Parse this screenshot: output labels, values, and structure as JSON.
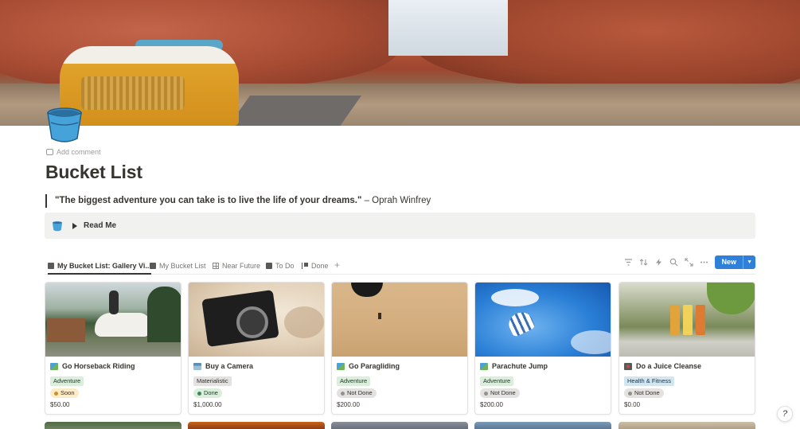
{
  "page": {
    "title": "Bucket List",
    "icon": "bucket-icon",
    "add_comment": "Add comment"
  },
  "quote": {
    "text": "\"The biggest adventure you can take is to live the life of your dreams.\"",
    "attribution": " – Oprah Winfrey"
  },
  "callout": {
    "icon": "bucket-icon",
    "toggle_label": "Read Me"
  },
  "tabs": [
    {
      "label": "My Bucket List: Gallery Vi...",
      "icon": "book-icon",
      "active": true
    },
    {
      "label": "My Bucket List",
      "icon": "book-icon",
      "active": false
    },
    {
      "label": "Near Future",
      "icon": "grid-icon",
      "active": false
    },
    {
      "label": "To Do",
      "icon": "book-open-icon",
      "active": false
    },
    {
      "label": "Done",
      "icon": "flag-icon",
      "active": false
    }
  ],
  "toolbar": {
    "new_label": "New",
    "icons": [
      "filter-icon",
      "sort-icon",
      "lightning-icon",
      "search-icon",
      "expand-icon",
      "more-icon"
    ]
  },
  "cards": [
    {
      "title": "Go Horseback Riding",
      "category": "Adventure",
      "category_color": "green",
      "status": "Soon",
      "status_color": "yellow",
      "price": "$50.00"
    },
    {
      "title": "Buy a Camera",
      "category": "Materialistic",
      "category_color": "gray",
      "status": "Done",
      "status_color": "green",
      "price": "$1,000.00"
    },
    {
      "title": "Go Paragliding",
      "category": "Adventure",
      "category_color": "green",
      "status": "Not Done",
      "status_color": "gray",
      "price": "$200.00"
    },
    {
      "title": "Parachute Jump",
      "category": "Adventure",
      "category_color": "green",
      "status": "Not Done",
      "status_color": "gray",
      "price": "$200.00"
    },
    {
      "title": "Do a Juice Cleanse",
      "category": "Health & Fitness",
      "category_color": "blue",
      "status": "Not Done",
      "status_color": "gray",
      "price": "$0.00"
    }
  ],
  "help_button": "?"
}
